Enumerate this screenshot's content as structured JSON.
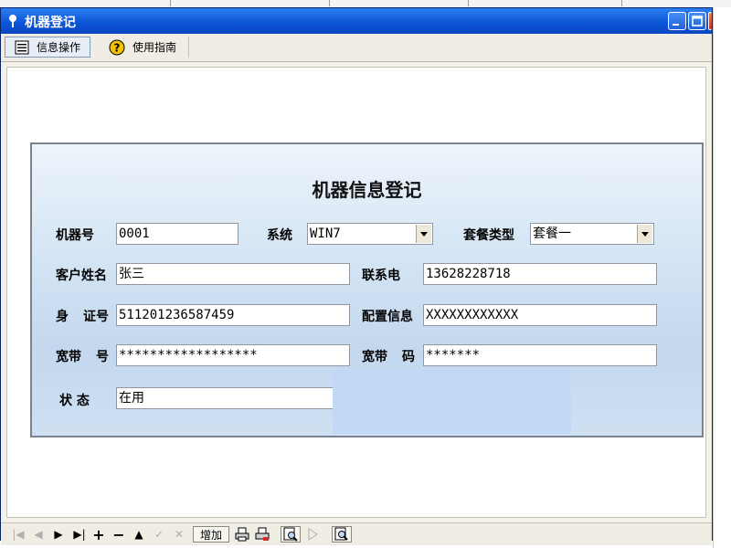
{
  "window": {
    "title": "机器登记"
  },
  "toolbar": {
    "info_label": "信息操作",
    "help_label": "使用指南"
  },
  "form": {
    "title": "机器信息登记",
    "machine_no_label": "机器号",
    "machine_no_value": "0001",
    "system_label": "系统",
    "system_value": "WIN7",
    "package_label": "套餐类型",
    "package_value": "套餐一",
    "customer_label": "客户姓名",
    "customer_value": "张三",
    "phone_label": "联系电",
    "phone_value": "13628228718",
    "id_label_part1": "身",
    "id_label_part2": "证号",
    "id_value": "511201236587459",
    "config_label": "配置信息",
    "config_value": "XXXXXXXXXXXX",
    "bb_account_label_part1": "宽带",
    "bb_account_label_part2": "号",
    "bb_account_value": "******************",
    "bb_password_label_part1": "宽带",
    "bb_password_label_part2": "码",
    "bb_password_value": "*******",
    "status_label": "状  态",
    "status_value": "在用"
  },
  "navbar": {
    "first": "|◀",
    "prev": "◀",
    "next": "▶",
    "last": "▶|",
    "add": "+",
    "delete": "−",
    "edit": "▲",
    "post": "✓",
    "cancel": "✕",
    "add_button_label": "增加",
    "icons": [
      "print-icon",
      "print-preview-icon",
      "report-icon",
      "play-icon",
      "search-icon"
    ]
  },
  "colors": {
    "titlebar": "#0b53d6",
    "panel": "#c3d8ee",
    "overlay": "#c3d8f6"
  }
}
